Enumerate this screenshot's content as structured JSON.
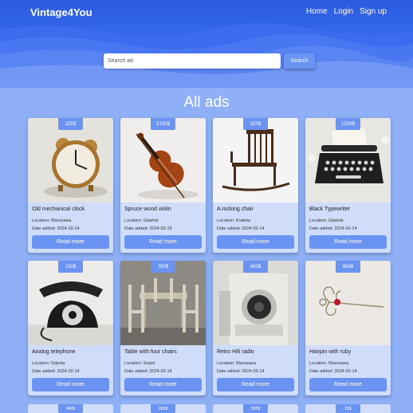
{
  "header": {
    "brand": "Vintage4You",
    "nav": [
      "Home",
      "Login",
      "Sign up"
    ]
  },
  "search": {
    "placeholder": "Search ad",
    "button_label": "Search"
  },
  "page_title": "All ads",
  "read_more_label": "Read more",
  "colors": {
    "header_dark": "#2b5be0",
    "page_bg": "#8fb0f6",
    "card_bg": "#cfdcfa",
    "accent": "#6b93f2"
  },
  "ads": [
    {
      "title": "Old mechanical clock",
      "price": "225$",
      "location": "Location: Warszawa",
      "date": "Date added: 2024-02-14",
      "image_icon": "alarm-clock-icon"
    },
    {
      "title": "Spruce wood violin",
      "price": "5100$",
      "location": "Location: Gdańsk",
      "date": "Date added: 2024-02-15",
      "image_icon": "violin-icon"
    },
    {
      "title": "A rocking chair",
      "price": "320$",
      "location": "Location: Kraków",
      "date": "Date added: 2024-02-14",
      "image_icon": "rocking-chair-icon"
    },
    {
      "title": "Black Typewriter",
      "price": "1200$",
      "location": "Location: Gdańsk",
      "date": "Date added: 2024-02-14",
      "image_icon": "typewriter-icon"
    },
    {
      "title": "Analog telephone",
      "price": "150$",
      "location": "Location: Gdynia",
      "date": "Date added: 2024-02-14",
      "image_icon": "telephone-icon"
    },
    {
      "title": "Table with four chairs",
      "price": "760$",
      "location": "Location: Sopot",
      "date": "Date added: 2024-02-14",
      "image_icon": "table-chairs-icon"
    },
    {
      "title": "Retro Hifi radio",
      "price": "450$",
      "location": "Location: Warszawa",
      "date": "Date added: 2024-02-14",
      "image_icon": "speaker-icon"
    },
    {
      "title": "Hairpin with ruby",
      "price": "865$",
      "location": "Location: Warszawa",
      "date": "Date added: 2024-02-14",
      "image_icon": "hairpin-icon"
    }
  ],
  "partial_prices": [
    "460$",
    "800$",
    "555$",
    "25$"
  ]
}
